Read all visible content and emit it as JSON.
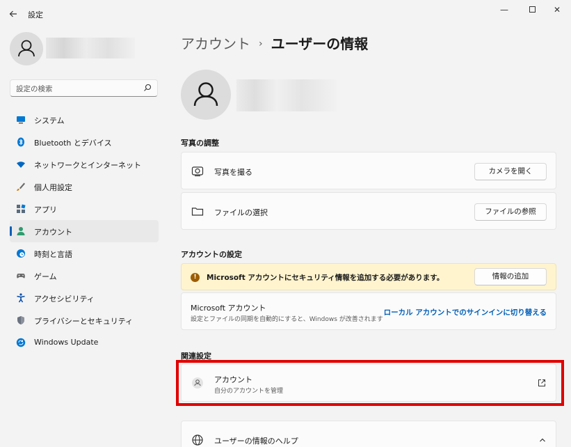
{
  "window": {
    "title": "設定",
    "back_icon": "back-arrow-icon",
    "minimize_glyph": "—",
    "close_glyph": "✕"
  },
  "sidebar": {
    "search_placeholder": "設定の検索",
    "items": [
      {
        "label": "システム",
        "icon": "system-icon",
        "color": "#0078d4",
        "active": false
      },
      {
        "label": "Bluetooth とデバイス",
        "icon": "bluetooth-icon",
        "color": "#0078d4",
        "active": false
      },
      {
        "label": "ネットワークとインターネット",
        "icon": "wifi-icon",
        "color": "#0067c0",
        "active": false
      },
      {
        "label": "個人用設定",
        "icon": "brush-icon",
        "color": "#d47a00",
        "active": false
      },
      {
        "label": "アプリ",
        "icon": "apps-icon",
        "color": "#5a6b7d",
        "active": false
      },
      {
        "label": "アカウント",
        "icon": "account-icon",
        "color": "#2d9c6e",
        "active": true
      },
      {
        "label": "時刻と言語",
        "icon": "clock-globe-icon",
        "color": "#0078d4",
        "active": false
      },
      {
        "label": "ゲーム",
        "icon": "gamepad-icon",
        "color": "#6b6b6b",
        "active": false
      },
      {
        "label": "アクセシビリティ",
        "icon": "accessibility-icon",
        "color": "#0a4fa6",
        "active": false
      },
      {
        "label": "プライバシーとセキュリティ",
        "icon": "shield-icon",
        "color": "#6b7280",
        "active": false
      },
      {
        "label": "Windows Update",
        "icon": "windows-update-icon",
        "color": "#0078d4",
        "active": false
      }
    ]
  },
  "main": {
    "breadcrumb_parent": "アカウント",
    "breadcrumb_separator": "›",
    "breadcrumb_current": "ユーザーの情報",
    "photo_section_title": "写真の調整",
    "take_photo_label": "写真を撮る",
    "open_camera_button": "カメラを開く",
    "choose_file_label": "ファイルの選択",
    "browse_files_button": "ファイルの参照",
    "account_settings_title": "アカウントの設定",
    "warning_text": "Microsoft アカウントにセキュリティ情報を追加する必要があります。",
    "add_info_button": "情報の追加",
    "ms_account_title": "Microsoft アカウント",
    "ms_account_desc": "設定とファイルの同期を自動的にすると、Windows が改善されます",
    "switch_local_link": "ローカル アカウントでのサインインに切り替える",
    "related_settings_title": "関連設定",
    "related_account_title": "アカウント",
    "related_account_desc": "自分のアカウントを管理",
    "help_title": "ユーザーの情報のヘルプ"
  },
  "colors": {
    "accent": "#005fb8",
    "warning_bg": "#fff4ce",
    "highlight_border": "#e00000"
  }
}
